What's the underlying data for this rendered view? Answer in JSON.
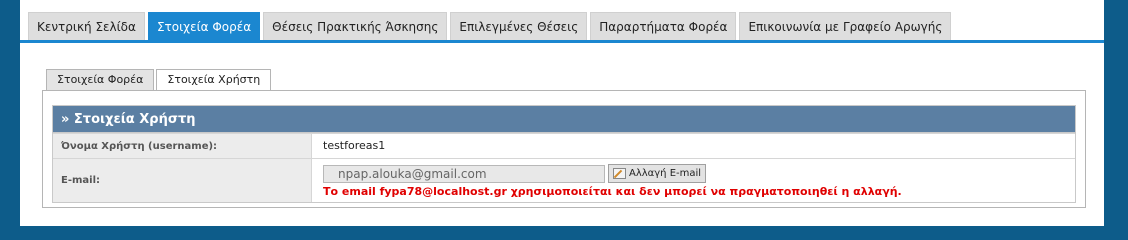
{
  "topnav": {
    "tabs": [
      {
        "label": "Κεντρική Σελίδα",
        "active": false
      },
      {
        "label": "Στοιχεία Φορέα",
        "active": true
      },
      {
        "label": "Θέσεις Πρακτικής Άσκησης",
        "active": false
      },
      {
        "label": "Επιλεγμένες Θέσεις",
        "active": false
      },
      {
        "label": "Παραρτήματα Φορέα",
        "active": false
      },
      {
        "label": "Επικοινωνία με Γραφείο Αρωγής",
        "active": false
      }
    ]
  },
  "subtabs": [
    {
      "label": "Στοιχεία Φορέα",
      "active": false
    },
    {
      "label": "Στοιχεία Χρήστη",
      "active": true
    }
  ],
  "section": {
    "title": "» Στοιχεία Χρήστη",
    "username_label": "Όνομα Χρήστη (username):",
    "username_value": "testforeas1",
    "email_label": "E-mail:",
    "email_value": "npap.alouka@gmail.com",
    "change_email_button": "Αλλαγή E-mail",
    "error_message": "Το email fypa78@localhost.gr χρησιμοποιείται και δεν μπορεί να πραγματοποιηθεί η αλλαγή."
  },
  "colors": {
    "accent": "#1b87d0",
    "section_header": "#5b7fa3",
    "error": "#e00000",
    "outer_bg": "#0d5c8a"
  }
}
